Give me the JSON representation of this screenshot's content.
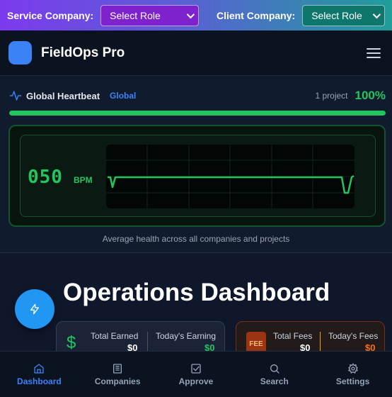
{
  "rolebar": {
    "service_label": "Service Company:",
    "service_select": "Select Role",
    "client_label": "Client Company:",
    "client_select": "Select Role"
  },
  "header": {
    "brand": "FieldOps Pro",
    "menu_icon": "hamburger-icon"
  },
  "heartbeat": {
    "title": "Global Heartbeat",
    "scope": "Global",
    "count": "1 project",
    "percent": "100%",
    "progress": 1.0,
    "bpm": "050",
    "bpm_unit": "BPM",
    "footer": "Average health across all companies and projects",
    "colors": {
      "healthy": "#22c55e"
    }
  },
  "main": {
    "title": "Operations Dashboard",
    "fab_icon": "bolt-icon",
    "earnings_card": {
      "icon": "dollar-icon",
      "total_label": "Total Earned",
      "total_value": "$0",
      "today_label": "Today's Earning",
      "today_value": "$0"
    },
    "fees_card": {
      "icon_text": "FEE",
      "total_label": "Total Fees",
      "total_value": "$0",
      "today_label": "Today's Fees",
      "today_value": "$0"
    }
  },
  "nav": {
    "items": [
      {
        "label": "Dashboard",
        "icon": "home-icon",
        "active": true
      },
      {
        "label": "Companies",
        "icon": "building-icon",
        "active": false
      },
      {
        "label": "Approve",
        "icon": "checkbox-icon",
        "active": false
      },
      {
        "label": "Search",
        "icon": "search-icon",
        "active": false
      },
      {
        "label": "Settings",
        "icon": "gear-icon",
        "active": false
      }
    ]
  }
}
